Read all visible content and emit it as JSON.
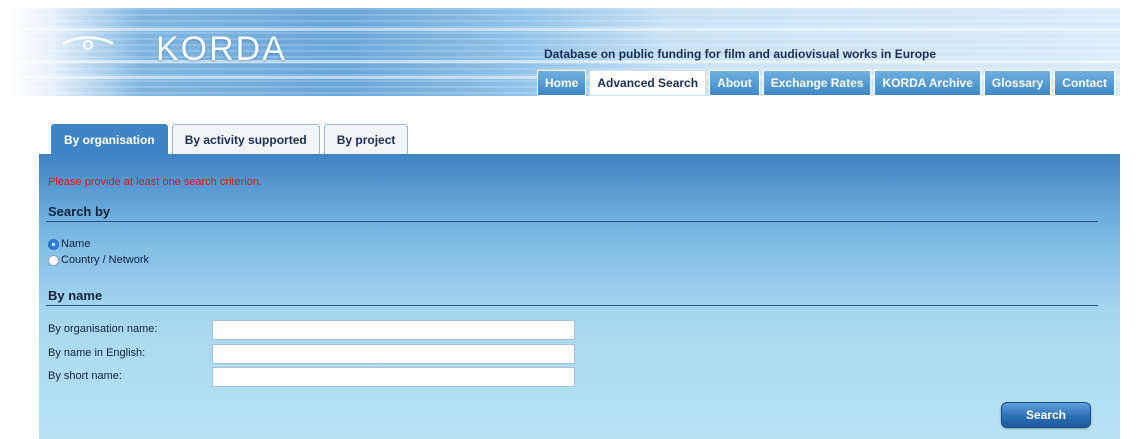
{
  "header": {
    "logo_text": "KORDA",
    "tagline": "Database on public funding for film and audiovisual works in Europe"
  },
  "nav": {
    "tabs": [
      {
        "label": "Home",
        "active": false
      },
      {
        "label": "Advanced Search",
        "active": true
      },
      {
        "label": "About",
        "active": false
      },
      {
        "label": "Exchange Rates",
        "active": false
      },
      {
        "label": "KORDA Archive",
        "active": false
      },
      {
        "label": "Glossary",
        "active": false
      },
      {
        "label": "Contact",
        "active": false
      }
    ]
  },
  "search_tabs": [
    {
      "label": "By organisation",
      "active": true
    },
    {
      "label": "By activity supported",
      "active": false
    },
    {
      "label": "By project",
      "active": false
    }
  ],
  "form": {
    "error": "Please provide at least one search criterion.",
    "search_by_title": "Search by",
    "radios": [
      {
        "label": "Name",
        "checked": true
      },
      {
        "label": "Country / Network",
        "checked": false
      }
    ],
    "by_name_title": "By name",
    "fields": [
      {
        "label": "By organisation name:",
        "value": ""
      },
      {
        "label": "By name in English:",
        "value": ""
      },
      {
        "label": "By short name:",
        "value": ""
      }
    ],
    "search_button": "Search"
  },
  "colors": {
    "error": "#e8121a",
    "tab_active": "#3f84c4",
    "nav_tab": "#4a90cc"
  }
}
